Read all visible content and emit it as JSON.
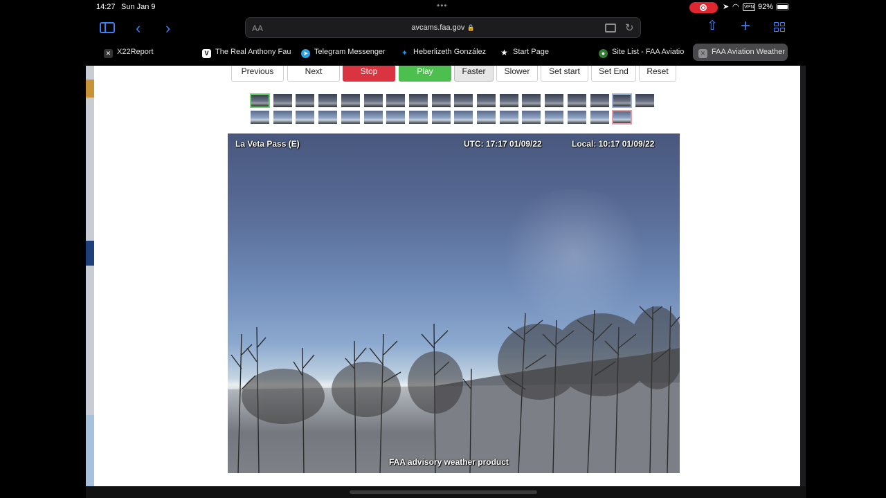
{
  "status_bar": {
    "time": "14:27",
    "date": "Sun Jan 9",
    "battery": "92%",
    "vpn": "VPN"
  },
  "address_bar": {
    "text_size_label": "AA",
    "url": "avcams.faa.gov"
  },
  "tabs": [
    {
      "label": "X22Report",
      "icon": "x22-favicon"
    },
    {
      "label": "The Real Anthony Fau",
      "icon": "v-favicon"
    },
    {
      "label": "Telegram Messenger",
      "icon": "telegram-favicon"
    },
    {
      "label": "Heberlizeth González",
      "icon": "twitter-favicon"
    },
    {
      "label": "Start Page",
      "icon": "star-icon"
    },
    {
      "label": "Site List - FAA Aviatio",
      "icon": "faa-favicon"
    },
    {
      "label": "FAA Aviation Weather",
      "icon": "close-icon",
      "active": true
    }
  ],
  "controls": {
    "previous": "Previous",
    "next": "Next",
    "stop": "Stop",
    "play": "Play",
    "faster": "Faster",
    "slower": "Slower",
    "set_start": "Set start",
    "set_end": "Set End",
    "reset": "Reset"
  },
  "camera": {
    "site": "La Veta Pass (E)",
    "utc": "UTC: 17:17 01/09/22",
    "local": "Local: 10:17 01/09/22",
    "footer": "FAA advisory weather product"
  },
  "colors": {
    "stop": "#d9343f",
    "play": "#4cbf4f",
    "accent": "#3b82f6"
  }
}
